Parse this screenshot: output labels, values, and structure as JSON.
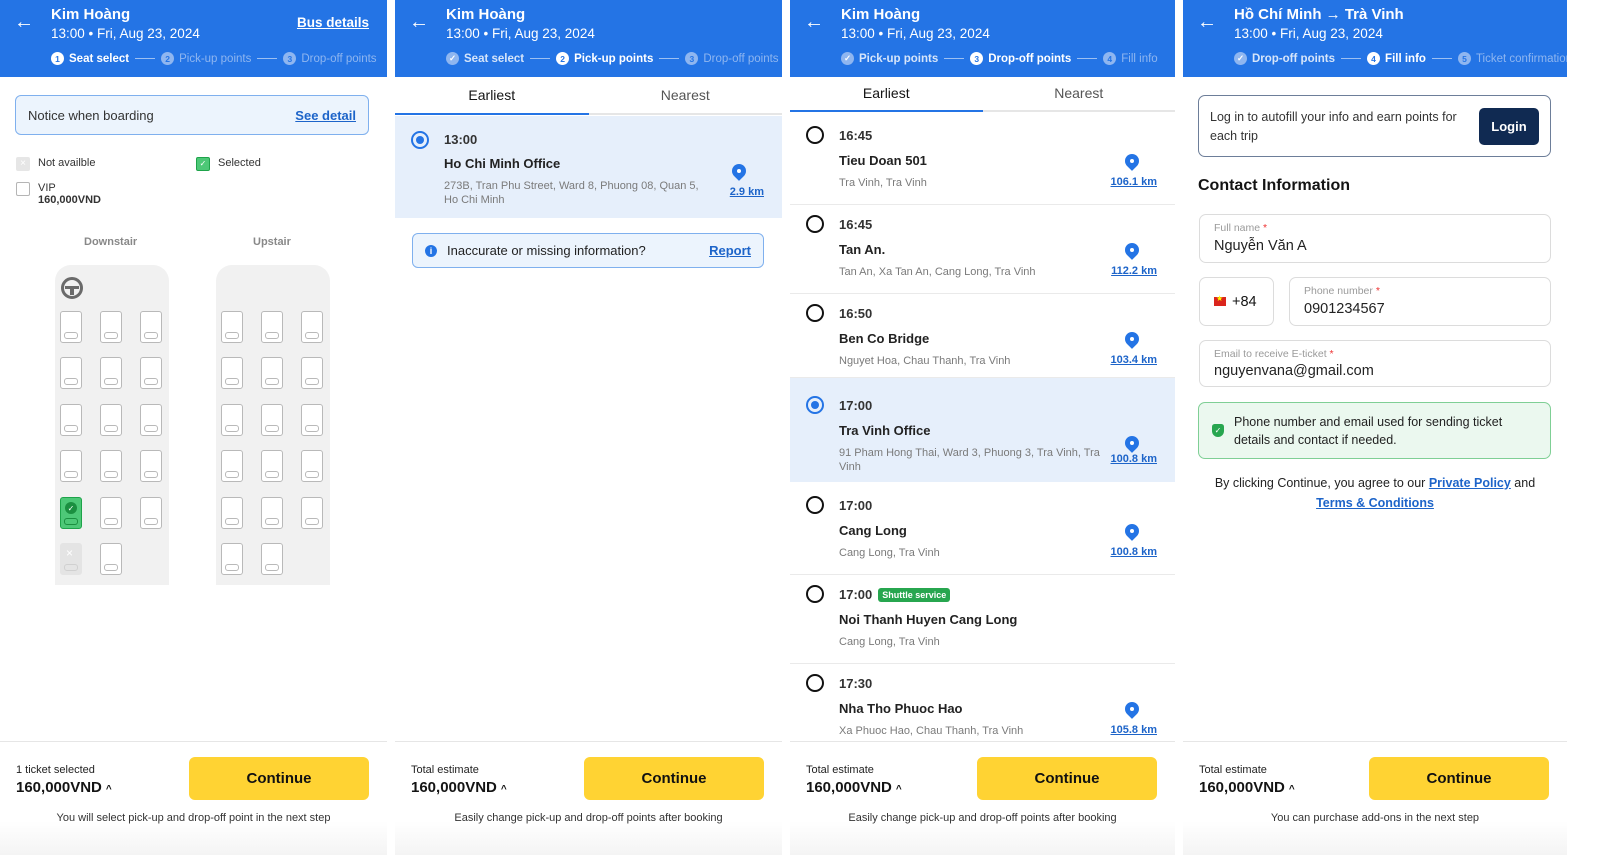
{
  "panel1": {
    "header": {
      "title": "Kim Hoàng",
      "subtitle": "13:00 • Fri, Aug 23, 2024",
      "link": "Bus details",
      "steps": [
        {
          "n": "1",
          "label": "Seat select",
          "state": "active"
        },
        {
          "n": "2",
          "label": "Pick-up points",
          "state": "dim"
        },
        {
          "n": "3",
          "label": "Drop-off points",
          "state": "dim"
        }
      ]
    },
    "notice": {
      "text": "Notice when boarding",
      "link": "See detail"
    },
    "legend": {
      "not_available": "Not availble",
      "selected": "Selected",
      "vip": "VIP",
      "vip_price": "160,000VND"
    },
    "decks": {
      "downstair": "Downstair",
      "upstair": "Upstair"
    },
    "footer": {
      "label": "1 ticket selected",
      "price": "160,000VND",
      "button": "Continue",
      "note": "You will select pick-up and drop-off point in the next step"
    }
  },
  "panel2": {
    "header": {
      "title": "Kim Hoàng",
      "subtitle": "13:00 • Fri, Aug 23, 2024",
      "steps": [
        {
          "n": "✓",
          "label": "Seat select",
          "state": "done"
        },
        {
          "n": "2",
          "label": "Pick-up points",
          "state": "active"
        },
        {
          "n": "3",
          "label": "Drop-off points",
          "state": "dim"
        }
      ]
    },
    "tabs": [
      "Earliest",
      "Nearest"
    ],
    "points": [
      {
        "time": "13:00",
        "name": "Ho Chi Minh Office",
        "address": "273B, Tran Phu Street, Ward 8, Phuong 08, Quan 5, Ho Chi Minh",
        "distance": "2.9 km",
        "selected": true
      }
    ],
    "report": {
      "text": "Inaccurate or missing information?",
      "link": "Report"
    },
    "footer": {
      "label": "Total estimate",
      "price": "160,000VND",
      "button": "Continue",
      "note": "Easily change pick-up and drop-off points after booking"
    }
  },
  "panel3": {
    "header": {
      "title": "Kim Hoàng",
      "subtitle": "13:00 • Fri, Aug 23, 2024",
      "steps": [
        {
          "n": "✓",
          "label": "Pick-up points",
          "state": "done"
        },
        {
          "n": "3",
          "label": "Drop-off points",
          "state": "active"
        },
        {
          "n": "4",
          "label": "Fill info",
          "state": "dim"
        }
      ]
    },
    "tabs": [
      "Earliest",
      "Nearest"
    ],
    "points": [
      {
        "time": "16:45",
        "name": "Tieu Doan 501",
        "address": "Tra Vinh, Tra Vinh",
        "distance": "106.1 km"
      },
      {
        "time": "16:45",
        "name": "Tan An.",
        "address": "Tan An, Xa Tan An, Cang Long, Tra Vinh",
        "distance": "112.2 km"
      },
      {
        "time": "16:50",
        "name": "Ben Co Bridge",
        "address": "Nguyet Hoa, Chau Thanh, Tra Vinh",
        "distance": "103.4 km"
      },
      {
        "time": "17:00",
        "name": "Tra Vinh Office",
        "address": "91 Pham Hong Thai, Ward 3, Phuong 3, Tra Vinh, Tra Vinh",
        "distance": "100.8 km",
        "selected": true
      },
      {
        "time": "17:00",
        "name": "Cang Long",
        "address": "Cang Long, Tra Vinh",
        "distance": "100.8 km"
      },
      {
        "time": "17:00",
        "badge": "Shuttle service",
        "name": "Noi Thanh Huyen Cang Long",
        "address": "Cang Long, Tra Vinh"
      },
      {
        "time": "17:30",
        "name": "Nha Tho Phuoc Hao",
        "address": "Xa Phuoc Hao, Chau Thanh, Tra Vinh",
        "distance": "105.8 km"
      }
    ],
    "footer": {
      "label": "Total estimate",
      "price": "160,000VND",
      "button": "Continue",
      "note": "Easily change pick-up and drop-off points after booking"
    }
  },
  "panel4": {
    "header": {
      "title": "Hồ Chí Minh → Trà Vinh",
      "subtitle": "13:00 • Fri, Aug 23, 2024",
      "steps": [
        {
          "n": "✓",
          "label": "Drop-off points",
          "state": "done"
        },
        {
          "n": "4",
          "label": "Fill info",
          "state": "active"
        },
        {
          "n": "5",
          "label": "Ticket confirmation",
          "state": "dim"
        }
      ]
    },
    "login": {
      "text": "Log in to autofill your info and earn points for each trip",
      "button": "Login"
    },
    "contact_title": "Contact Information",
    "fields": {
      "full_name": {
        "label": "Full name",
        "value": "Nguyễn Văn A"
      },
      "country_code": "+84",
      "phone": {
        "label": "Phone number",
        "value": "0901234567"
      },
      "email": {
        "label": "Email to receive E-ticket",
        "value": "nguyenvana@gmail.com"
      }
    },
    "required_mark": "*",
    "info": "Phone number and email used for sending ticket details and contact if needed.",
    "agree": {
      "prefix": "By clicking Continue, you agree to our ",
      "policy": "Private Policy",
      "and": " and ",
      "terms": "Terms & Conditions"
    },
    "footer": {
      "label": "Total estimate",
      "price": "160,000VND",
      "button": "Continue",
      "note": "You can purchase add-ons in the next step"
    }
  },
  "colors": {
    "primary": "#2474e5",
    "cta": "#ffd333",
    "success": "#27a64f",
    "login": "#102a52"
  }
}
